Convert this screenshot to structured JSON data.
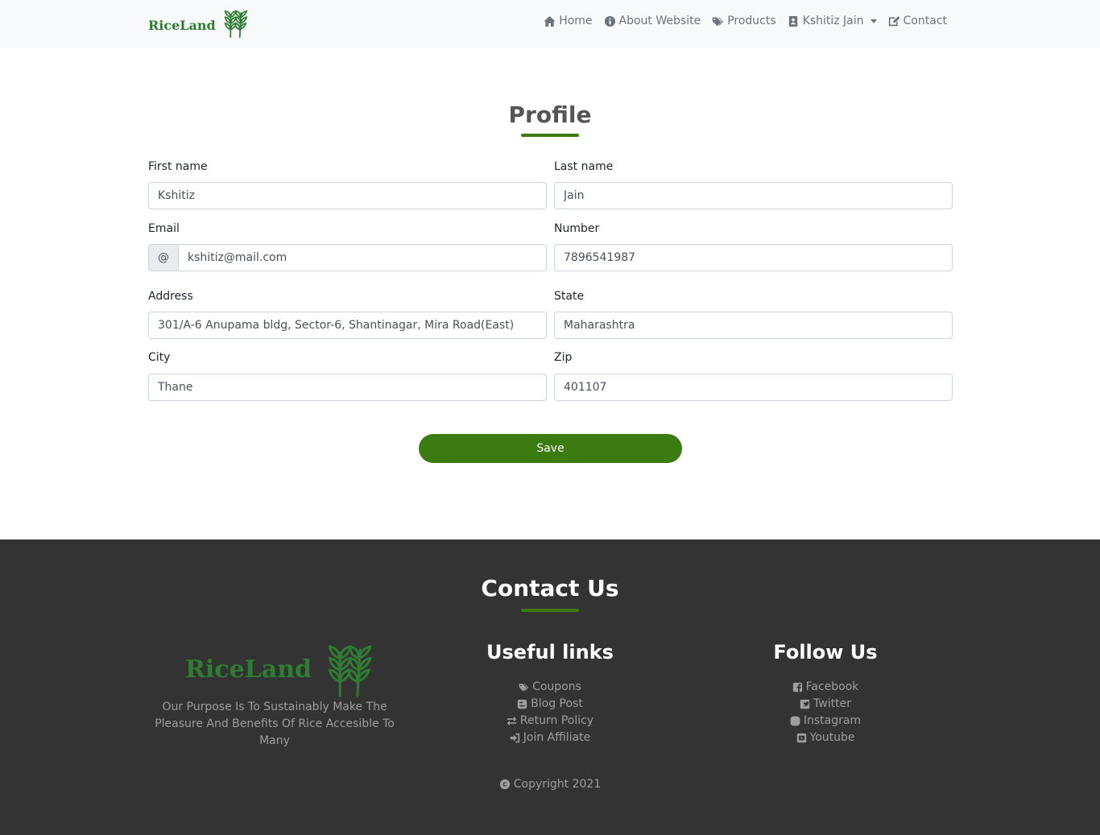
{
  "brand": {
    "name": "RiceLand",
    "icon": "wheat-icon"
  },
  "nav": {
    "items": [
      {
        "label": "Home",
        "icon": "home-icon"
      },
      {
        "label": "About Website",
        "icon": "info-circle-icon"
      },
      {
        "label": "Products",
        "icon": "tags-icon"
      },
      {
        "label": "Kshitiz Jain",
        "icon": "address-book-icon",
        "dropdown": true
      },
      {
        "label": "Contact",
        "icon": "edit-icon"
      }
    ]
  },
  "profile": {
    "title": "Profile",
    "fields": {
      "first_name": {
        "label": "First name",
        "value": "Kshitiz"
      },
      "last_name": {
        "label": "Last name",
        "value": "Jain"
      },
      "email": {
        "label": "Email",
        "addon": "@",
        "value": "kshitiz@mail.com"
      },
      "number": {
        "label": "Number",
        "value": "7896541987"
      },
      "address": {
        "label": "Address",
        "value": "301/A-6 Anupama bldg, Sector-6, Shantinagar, Mira Road(East)"
      },
      "state": {
        "label": "State",
        "value": "Maharashtra"
      },
      "city": {
        "label": "City",
        "value": "Thane"
      },
      "zip": {
        "label": "Zip",
        "value": "401107"
      }
    },
    "save_label": "Save"
  },
  "footer": {
    "title": "Contact Us",
    "brand_name": "RiceLand",
    "description": "Our Purpose Is To Sustainably Make The Pleasure And Benefits Of Rice Accesible To Many",
    "useful_links": {
      "heading": "Useful links",
      "items": [
        {
          "label": "Coupons",
          "icon": "tags-icon"
        },
        {
          "label": "Blog Post",
          "icon": "blogger-icon"
        },
        {
          "label": "Return Policy",
          "icon": "exchange-icon"
        },
        {
          "label": "Join Affiliate",
          "icon": "sign-in-icon"
        }
      ]
    },
    "follow_us": {
      "heading": "Follow Us",
      "items": [
        {
          "label": "Facebook",
          "icon": "facebook-square-icon"
        },
        {
          "label": "Twitter",
          "icon": "twitter-square-icon"
        },
        {
          "label": "Instagram",
          "icon": "instagram-icon"
        },
        {
          "label": "Youtube",
          "icon": "youtube-square-icon"
        }
      ]
    },
    "copyright": "Copyright 2021"
  },
  "colors": {
    "accent": "#3c7a12",
    "brand": "#2e7d32",
    "footer_bg": "#333333",
    "navbar_bg": "#f8f9fa"
  }
}
